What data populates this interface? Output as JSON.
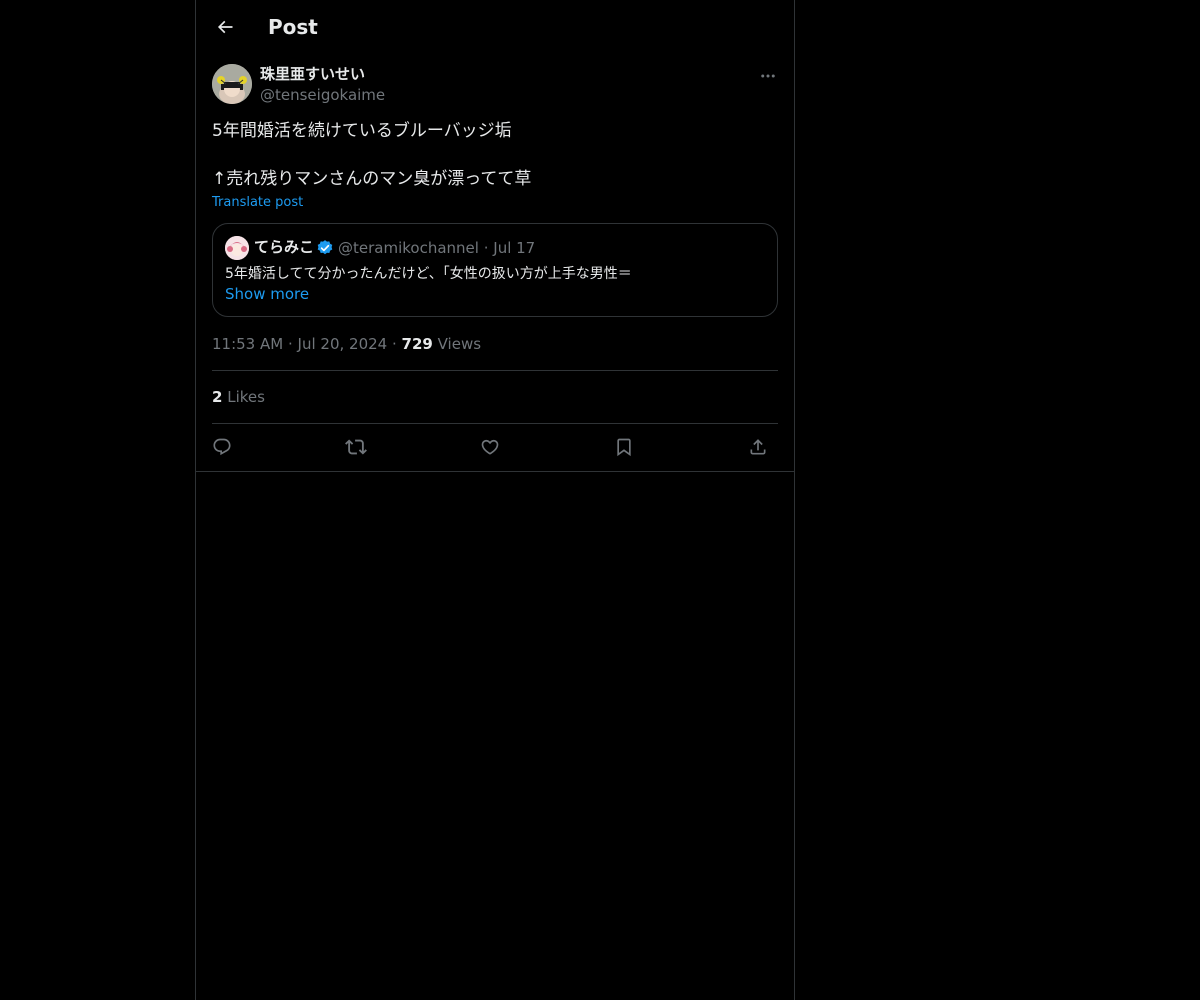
{
  "header": {
    "title": "Post",
    "back_icon": "arrow-left-icon"
  },
  "post": {
    "author_name": "珠里亜すいせい",
    "author_handle": "@tenseigokaime",
    "text": "5年間婚活を続けているブルーバッジ垢\n\n↑売れ残りマンさんのマン臭が漂ってて草",
    "translate_label": "Translate post",
    "time": "11:53 AM",
    "date": "Jul 20, 2024",
    "views_count": "729",
    "views_label": "Views",
    "likes_count": "2",
    "likes_label": "Likes"
  },
  "quote": {
    "author_name": "てらみこ",
    "author_handle": "@teramikochannel",
    "date": "Jul 17",
    "text": "5年婚活してて分かったんだけど、「女性の扱い方が上手な男性＝",
    "show_more_label": "Show more",
    "verified": true
  },
  "actions": [
    "reply-icon",
    "repost-icon",
    "like-icon",
    "bookmark-icon",
    "share-icon"
  ],
  "colors": {
    "background": "#000000",
    "text": "#e7e9ea",
    "secondary": "#71767b",
    "accent": "#1d9bf0",
    "border": "#2f3336"
  }
}
